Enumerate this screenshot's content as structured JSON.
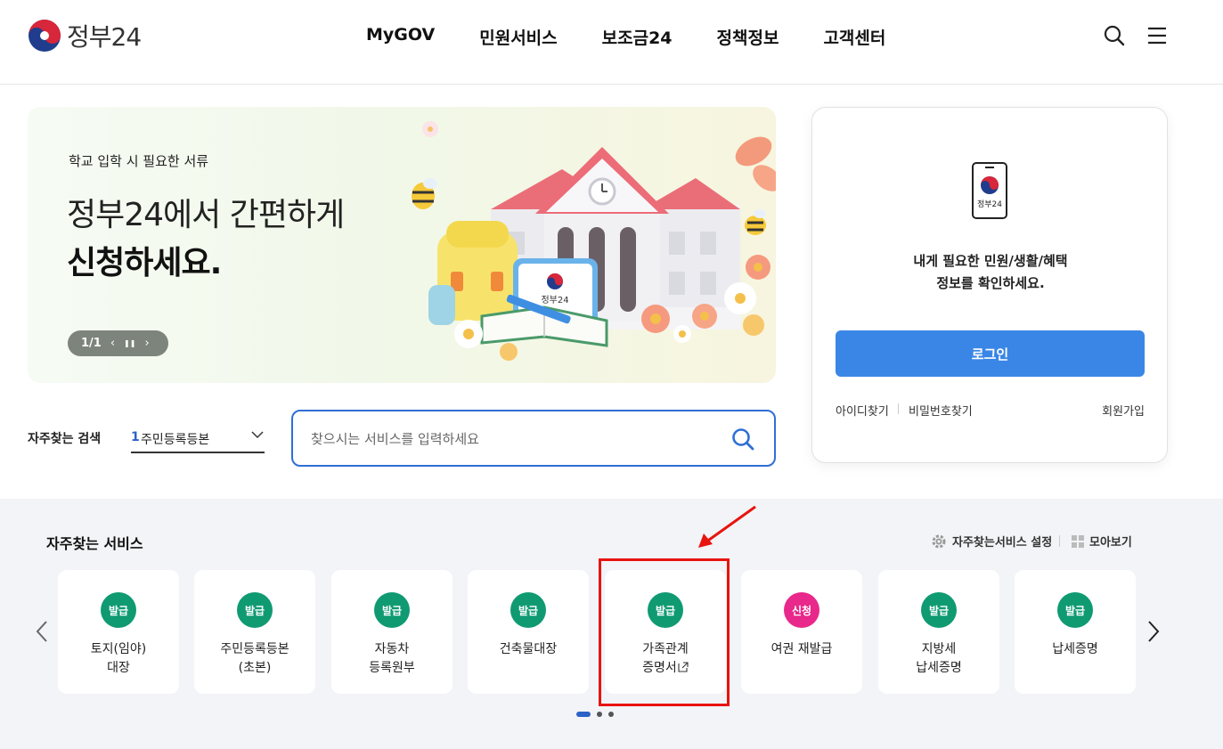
{
  "header": {
    "logo_text": "정부24",
    "nav": [
      "MyGOV",
      "민원서비스",
      "보조금24",
      "정책정보",
      "고객센터"
    ],
    "icons": [
      "search-icon",
      "hamburger-menu-icon"
    ]
  },
  "banner": {
    "subtitle": "학교 입학 시 필요한 서류",
    "title_line1": "정부24에서 간편하게",
    "title_line2": "신청하세요.",
    "pager": "1/1",
    "prev_symbol": "‹",
    "pause_symbol": "❚❚",
    "next_symbol": "›",
    "tablet_label": "정부24"
  },
  "quick_search": {
    "label": "자주찾는 검색",
    "selected_number": "1",
    "selected_text": "주민등록등본",
    "placeholder": "찾으시는 서비스를 입력하세요"
  },
  "login": {
    "phone_label": "정부24",
    "message_line1": "내게 필요한 민원/생활/혜택",
    "message_line2": "정보를 확인하세요.",
    "button": "로그인",
    "find_id": "아이디찾기",
    "find_pw": "비밀번호찾기",
    "join": "회원가입"
  },
  "services": {
    "title": "자주찾는 서비스",
    "setting": "자주찾는서비스 설정",
    "view_all": "모아보기",
    "items": [
      {
        "badge": "발급",
        "name": "토지(임야)\n대장"
      },
      {
        "badge": "발급",
        "name": "주민등록등본\n(초본)"
      },
      {
        "badge": "발급",
        "name": "자동차\n등록원부"
      },
      {
        "badge": "발급",
        "name": "건축물대장"
      },
      {
        "badge": "발급",
        "name": "가족관계\n증명서"
      },
      {
        "badge": "신청",
        "name": "여권 재발급"
      },
      {
        "badge": "발급",
        "name": "지방세\n납세증명"
      },
      {
        "badge": "발급",
        "name": "납세증명"
      }
    ]
  },
  "colors": {
    "primary_blue": "#3a86e6",
    "badge_green": "#0f9a72",
    "badge_pink": "#e8288a",
    "highlight_red": "#e8140f"
  }
}
